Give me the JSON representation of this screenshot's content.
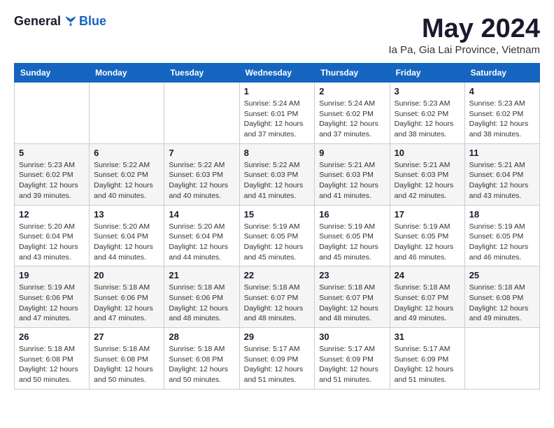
{
  "logo": {
    "general": "General",
    "blue": "Blue"
  },
  "title": "May 2024",
  "subtitle": "Ia Pa, Gia Lai Province, Vietnam",
  "headers": [
    "Sunday",
    "Monday",
    "Tuesday",
    "Wednesday",
    "Thursday",
    "Friday",
    "Saturday"
  ],
  "weeks": [
    [
      {
        "day": "",
        "info": ""
      },
      {
        "day": "",
        "info": ""
      },
      {
        "day": "",
        "info": ""
      },
      {
        "day": "1",
        "info": "Sunrise: 5:24 AM\nSunset: 6:01 PM\nDaylight: 12 hours and 37 minutes."
      },
      {
        "day": "2",
        "info": "Sunrise: 5:24 AM\nSunset: 6:02 PM\nDaylight: 12 hours and 37 minutes."
      },
      {
        "day": "3",
        "info": "Sunrise: 5:23 AM\nSunset: 6:02 PM\nDaylight: 12 hours and 38 minutes."
      },
      {
        "day": "4",
        "info": "Sunrise: 5:23 AM\nSunset: 6:02 PM\nDaylight: 12 hours and 38 minutes."
      }
    ],
    [
      {
        "day": "5",
        "info": "Sunrise: 5:23 AM\nSunset: 6:02 PM\nDaylight: 12 hours and 39 minutes."
      },
      {
        "day": "6",
        "info": "Sunrise: 5:22 AM\nSunset: 6:02 PM\nDaylight: 12 hours and 40 minutes."
      },
      {
        "day": "7",
        "info": "Sunrise: 5:22 AM\nSunset: 6:03 PM\nDaylight: 12 hours and 40 minutes."
      },
      {
        "day": "8",
        "info": "Sunrise: 5:22 AM\nSunset: 6:03 PM\nDaylight: 12 hours and 41 minutes."
      },
      {
        "day": "9",
        "info": "Sunrise: 5:21 AM\nSunset: 6:03 PM\nDaylight: 12 hours and 41 minutes."
      },
      {
        "day": "10",
        "info": "Sunrise: 5:21 AM\nSunset: 6:03 PM\nDaylight: 12 hours and 42 minutes."
      },
      {
        "day": "11",
        "info": "Sunrise: 5:21 AM\nSunset: 6:04 PM\nDaylight: 12 hours and 43 minutes."
      }
    ],
    [
      {
        "day": "12",
        "info": "Sunrise: 5:20 AM\nSunset: 6:04 PM\nDaylight: 12 hours and 43 minutes."
      },
      {
        "day": "13",
        "info": "Sunrise: 5:20 AM\nSunset: 6:04 PM\nDaylight: 12 hours and 44 minutes."
      },
      {
        "day": "14",
        "info": "Sunrise: 5:20 AM\nSunset: 6:04 PM\nDaylight: 12 hours and 44 minutes."
      },
      {
        "day": "15",
        "info": "Sunrise: 5:19 AM\nSunset: 6:05 PM\nDaylight: 12 hours and 45 minutes."
      },
      {
        "day": "16",
        "info": "Sunrise: 5:19 AM\nSunset: 6:05 PM\nDaylight: 12 hours and 45 minutes."
      },
      {
        "day": "17",
        "info": "Sunrise: 5:19 AM\nSunset: 6:05 PM\nDaylight: 12 hours and 46 minutes."
      },
      {
        "day": "18",
        "info": "Sunrise: 5:19 AM\nSunset: 6:05 PM\nDaylight: 12 hours and 46 minutes."
      }
    ],
    [
      {
        "day": "19",
        "info": "Sunrise: 5:19 AM\nSunset: 6:06 PM\nDaylight: 12 hours and 47 minutes."
      },
      {
        "day": "20",
        "info": "Sunrise: 5:18 AM\nSunset: 6:06 PM\nDaylight: 12 hours and 47 minutes."
      },
      {
        "day": "21",
        "info": "Sunrise: 5:18 AM\nSunset: 6:06 PM\nDaylight: 12 hours and 48 minutes."
      },
      {
        "day": "22",
        "info": "Sunrise: 5:18 AM\nSunset: 6:07 PM\nDaylight: 12 hours and 48 minutes."
      },
      {
        "day": "23",
        "info": "Sunrise: 5:18 AM\nSunset: 6:07 PM\nDaylight: 12 hours and 48 minutes."
      },
      {
        "day": "24",
        "info": "Sunrise: 5:18 AM\nSunset: 6:07 PM\nDaylight: 12 hours and 49 minutes."
      },
      {
        "day": "25",
        "info": "Sunrise: 5:18 AM\nSunset: 6:08 PM\nDaylight: 12 hours and 49 minutes."
      }
    ],
    [
      {
        "day": "26",
        "info": "Sunrise: 5:18 AM\nSunset: 6:08 PM\nDaylight: 12 hours and 50 minutes."
      },
      {
        "day": "27",
        "info": "Sunrise: 5:18 AM\nSunset: 6:08 PM\nDaylight: 12 hours and 50 minutes."
      },
      {
        "day": "28",
        "info": "Sunrise: 5:18 AM\nSunset: 6:08 PM\nDaylight: 12 hours and 50 minutes."
      },
      {
        "day": "29",
        "info": "Sunrise: 5:17 AM\nSunset: 6:09 PM\nDaylight: 12 hours and 51 minutes."
      },
      {
        "day": "30",
        "info": "Sunrise: 5:17 AM\nSunset: 6:09 PM\nDaylight: 12 hours and 51 minutes."
      },
      {
        "day": "31",
        "info": "Sunrise: 5:17 AM\nSunset: 6:09 PM\nDaylight: 12 hours and 51 minutes."
      },
      {
        "day": "",
        "info": ""
      }
    ]
  ]
}
